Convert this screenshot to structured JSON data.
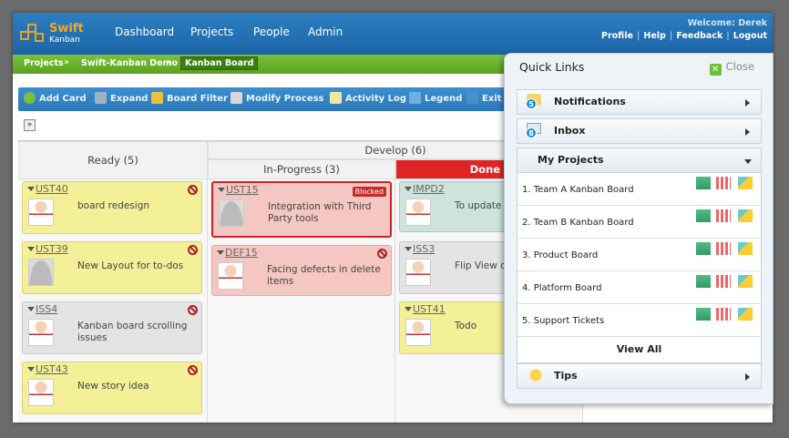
{
  "app": {
    "logo_name": "Swift",
    "logo_sub": "Kanban"
  },
  "nav": [
    "Dashboard",
    "Projects",
    "People",
    "Admin"
  ],
  "user": {
    "welcome": "Welcome: Derek",
    "links": [
      "Profile",
      "Help",
      "Feedback",
      "Logout"
    ]
  },
  "breadcrumb": [
    "Projects",
    "Swift-Kanban Demo",
    "Kanban Board"
  ],
  "toolbar": [
    "Add Card",
    "Expand",
    "Board Filter",
    "Modify Process",
    "Activity Log",
    "Legend",
    "Exit"
  ],
  "board": {
    "ready": "Ready (5)",
    "develop": "Develop (6)",
    "inprogress": "In-Progress (3)",
    "done": "Done (",
    "cards": {
      "ready": [
        {
          "id": "UST40",
          "text": "board redesign",
          "color": "yellow",
          "avatar": "face"
        },
        {
          "id": "UST39",
          "text": "New Layout for to-dos",
          "color": "yellow",
          "avatar": "blank"
        },
        {
          "id": "ISS4",
          "text": "Kanban board scrolling issues",
          "color": "grey",
          "avatar": "face"
        },
        {
          "id": "UST43",
          "text": "New story idea",
          "color": "yellow",
          "avatar": "face"
        }
      ],
      "inprogress": [
        {
          "id": "UST15",
          "text": "Integration with Third Party tools",
          "color": "pink",
          "avatar": "blank",
          "badge": "Blocked"
        },
        {
          "id": "DEF15",
          "text": "Facing defects in delete items",
          "color": "pink",
          "avatar": "face"
        }
      ],
      "done": [
        {
          "id": "IMPD2",
          "text": "To update t",
          "color": "teal",
          "avatar": "face"
        },
        {
          "id": "ISS3",
          "text": "Flip View o",
          "color": "grey",
          "avatar": "face"
        },
        {
          "id": "UST41",
          "text": "Todo",
          "color": "yellow",
          "avatar": "face"
        }
      ]
    }
  },
  "quicklinks": {
    "title": "Quick Links",
    "close": "Close",
    "notifications": {
      "label": "Notifications",
      "count": "5"
    },
    "inbox": {
      "label": "Inbox",
      "count": "8"
    },
    "myprojects": "My Projects",
    "projects": [
      "1. Team A Kanban Board",
      "2. Team B Kanban Board",
      "3. Product Board",
      "4. Platform Board",
      "5. Support Tickets"
    ],
    "viewall": "View All",
    "tips": "Tips"
  },
  "colors": {
    "header": "#1f6aab",
    "accent_green": "#6cc13b",
    "logo": "#f5a623",
    "blocked": "#cc2222"
  }
}
